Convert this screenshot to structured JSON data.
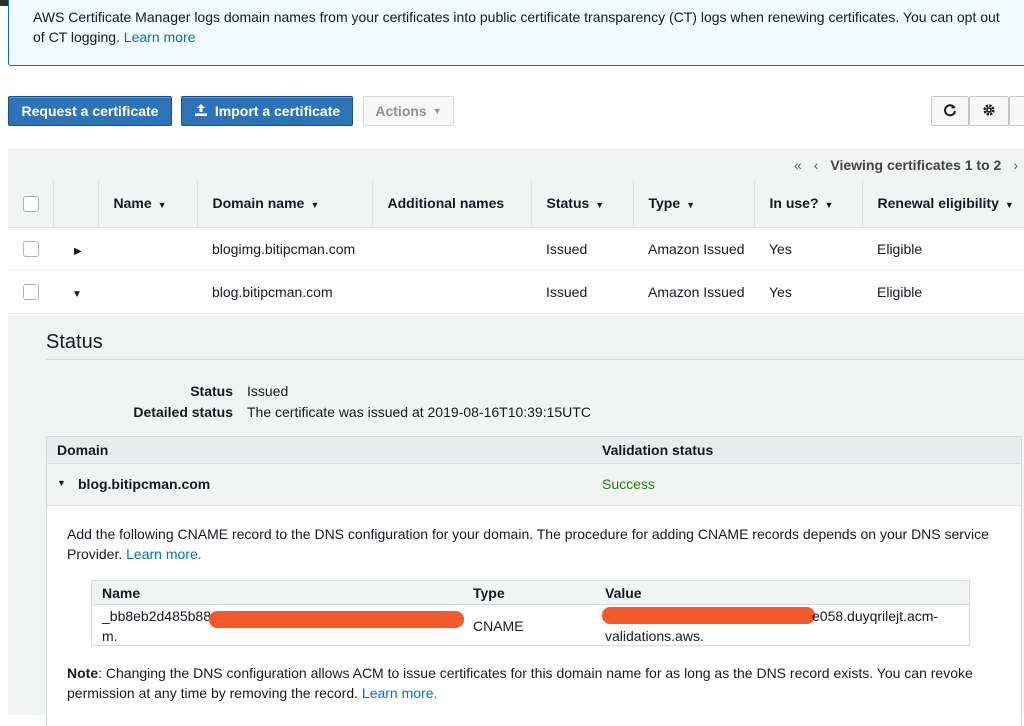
{
  "banner": {
    "text": "AWS Certificate Manager logs domain names from your certificates into public certificate transparency (CT) logs when renewing certificates. You can opt out of CT logging.",
    "link": "Learn more"
  },
  "toolbar": {
    "request_label": "Request a certificate",
    "import_label": "Import a certificate",
    "actions_label": "Actions",
    "refresh_icon": "refresh-icon",
    "settings_icon": "gear-icon"
  },
  "pager": {
    "first": "«",
    "prev": "‹",
    "text": "Viewing certificates 1 to 2",
    "next": "›"
  },
  "table": {
    "columns": [
      "Name",
      "Domain name",
      "Additional names",
      "Status",
      "Type",
      "In use?",
      "Renewal eligibility"
    ],
    "rows": [
      {
        "name": "",
        "domain": "blogimg.bitipcman.com",
        "additional": "",
        "status": "Issued",
        "type": "Amazon Issued",
        "in_use": "Yes",
        "renewal": "Eligible",
        "expanded": false
      },
      {
        "name": "",
        "domain": "blog.bitipcman.com",
        "additional": "",
        "status": "Issued",
        "type": "Amazon Issued",
        "in_use": "Yes",
        "renewal": "Eligible",
        "expanded": true
      }
    ]
  },
  "detail": {
    "title": "Status",
    "status_key": "Status",
    "status_val": "Issued",
    "detailed_key": "Detailed status",
    "detailed_val": "The certificate was issued at 2019-08-16T10:39:15UTC",
    "dv_col_domain": "Domain",
    "dv_col_validation": "Validation status",
    "dv_domain": "blog.bitipcman.com",
    "dv_status": "Success",
    "instructions": "Add the following CNAME record to the DNS configuration for your domain. The procedure for adding CNAME records depends on your DNS service",
    "instructions_2": "Provider.",
    "instructions_link": "Learn more.",
    "cname": {
      "col_name": "Name",
      "col_type": "Type",
      "col_value": "Value",
      "name_line1": "_bb8eb2d485b88",
      "name_line2": "m.",
      "type": "CNAME",
      "value_line1": "e058.duyqrilejt.acm-",
      "value_line2": "validations.aws."
    },
    "note_label": "Note",
    "note_text": ": Changing the DNS configuration allows ACM to issue certificates for this domain name for as long as the DNS record exists. You can revoke",
    "note_text_2": "permission at any time by removing the record.",
    "note_link": "Learn more."
  },
  "colors": {
    "primary": "#2e73b8",
    "success": "#1d8102",
    "link": "#0073bb",
    "redaction": "#f55a2c"
  }
}
